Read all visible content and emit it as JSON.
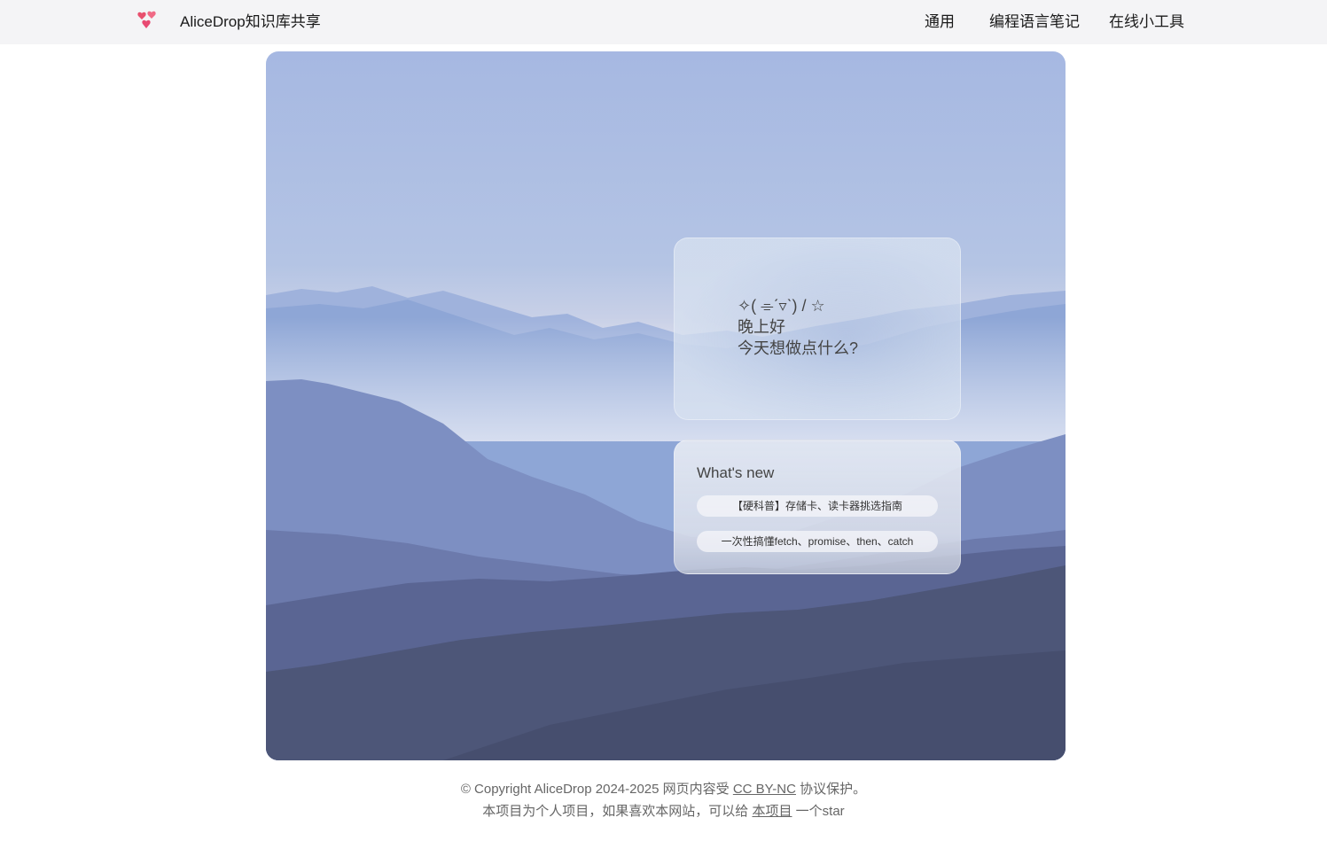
{
  "header": {
    "site_title": "AliceDrop知识库共享",
    "logo_icon": "heart-cluster-icon",
    "nav": [
      "通用",
      "编程语言笔记",
      "在线小工具"
    ]
  },
  "hero": {
    "greeting": {
      "kaomoji": "✧( ⌯ˊ▿ˋ) / ☆",
      "line1": "晚上好",
      "line2": "今天想做点什么?"
    },
    "whats_new": {
      "title": "What's new",
      "items": [
        "【硬科普】存储卡、读卡器挑选指南",
        "一次性搞懂fetch、promise、then、catch"
      ]
    }
  },
  "footer": {
    "line1_prefix": "© Copyright AliceDrop 2024-2025 网页内容受",
    "line1_link": "CC BY-NC",
    "line1_suffix": "协议保护。",
    "line2_prefix": "本项目为个人项目，如果喜欢本网站，可以给",
    "line2_link": "本项目",
    "line2_suffix": "一个star"
  },
  "colors": {
    "topbar": "#f4f4f6",
    "logo": "#e8506e",
    "sky_top": "#a6b8e2",
    "mountain_dark": "#4d5678"
  }
}
